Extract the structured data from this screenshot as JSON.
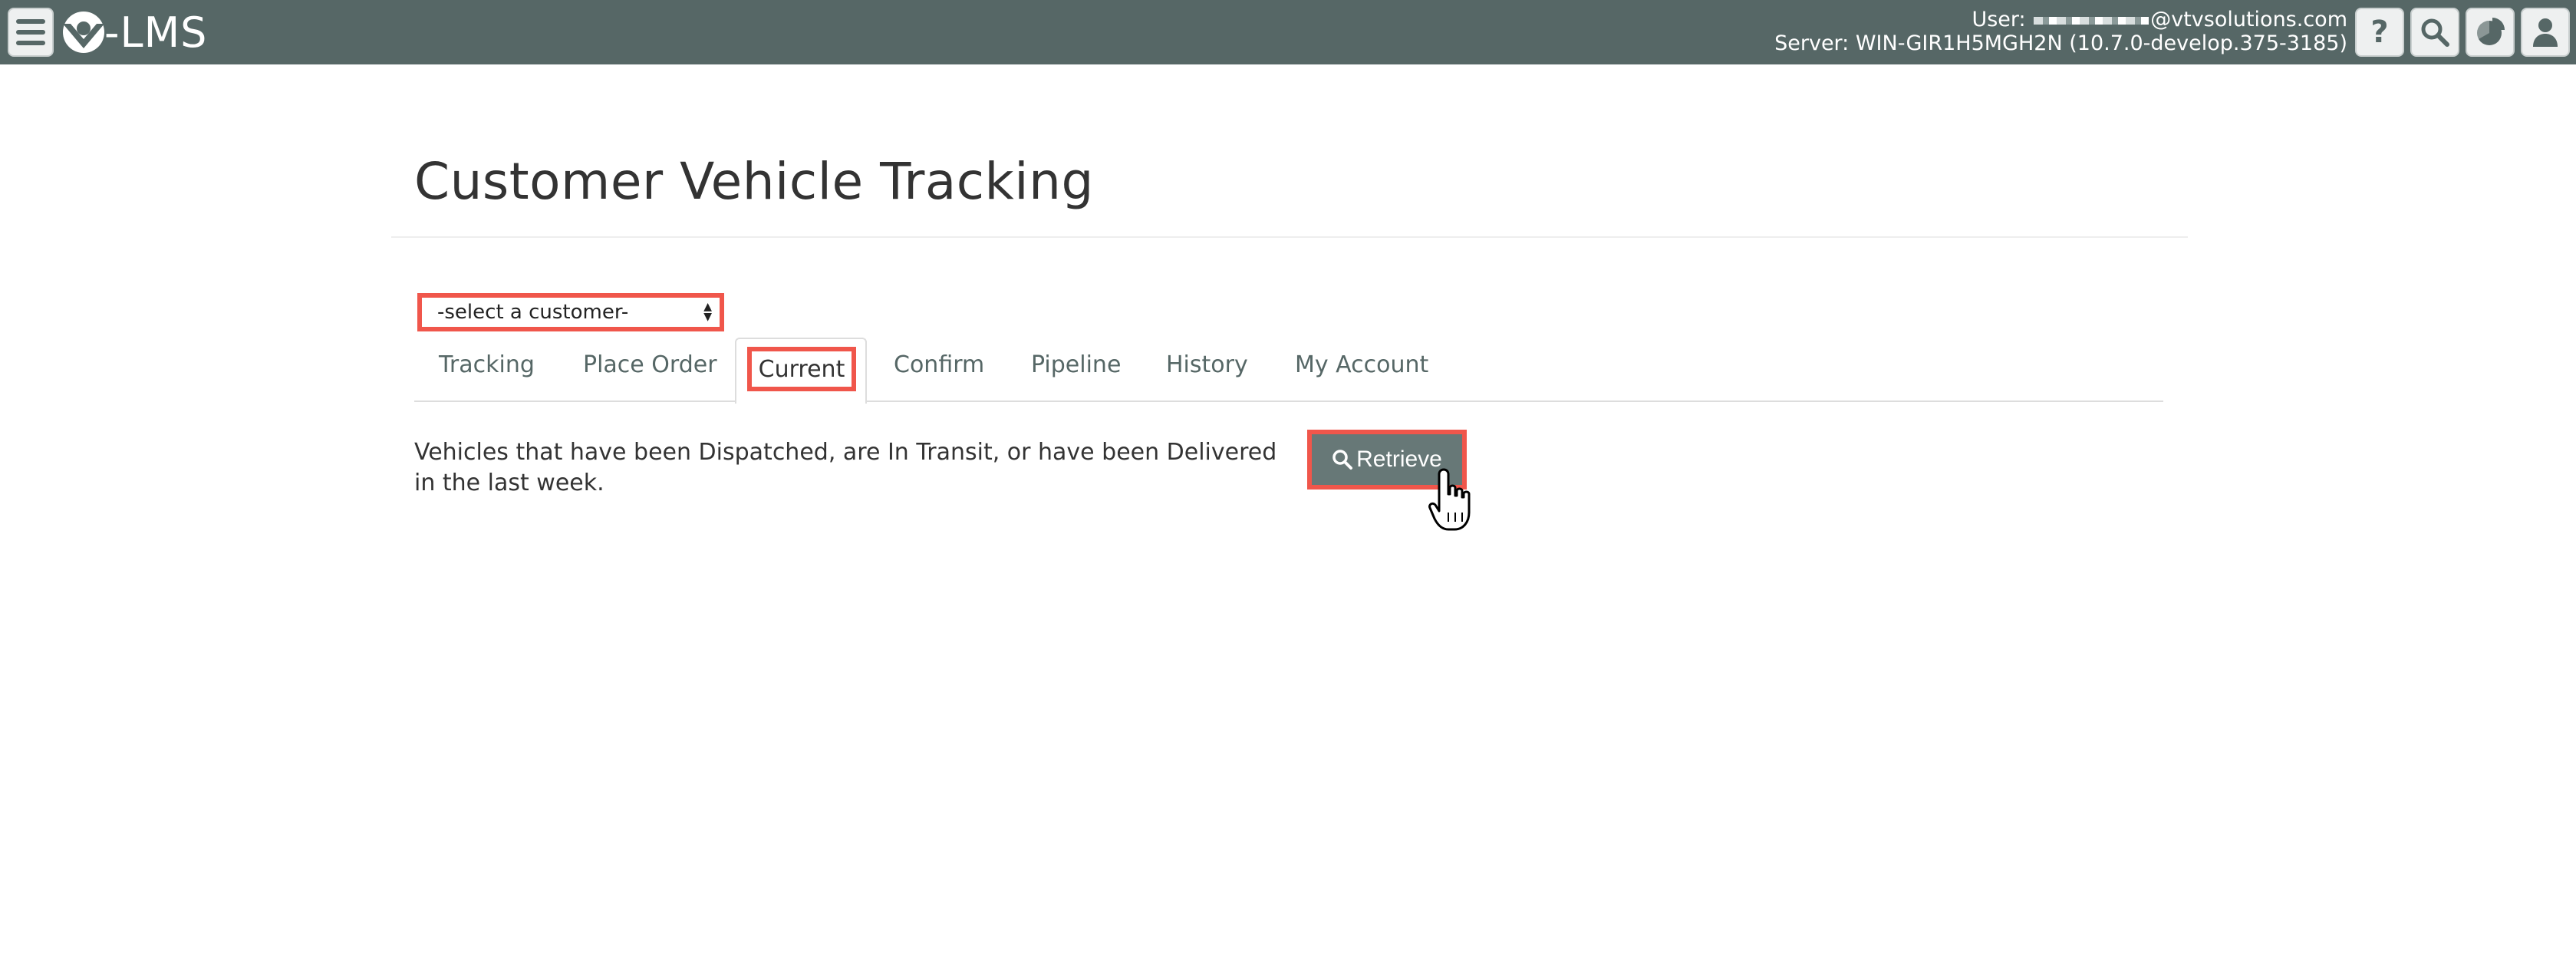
{
  "app": {
    "logo_text": "-LMS"
  },
  "topbar": {
    "user_prefix": "User:",
    "user_email_suffix": "@vtvsolutions.com",
    "server_line": "Server: WIN-GIR1H5MGH2N (10.7.0-develop.375-3185)",
    "icons": [
      "menu-icon",
      "help-icon",
      "search-icon",
      "pie-chart-icon",
      "user-icon"
    ],
    "help_glyph": "?"
  },
  "page": {
    "title": "Customer Vehicle Tracking"
  },
  "customer_select": {
    "selected": "-select a customer-"
  },
  "tabs": [
    {
      "label": "Tracking"
    },
    {
      "label": "Place Order"
    },
    {
      "label": "Current",
      "active": true
    },
    {
      "label": "Confirm"
    },
    {
      "label": "Pipeline"
    },
    {
      "label": "History"
    },
    {
      "label": "My Account"
    }
  ],
  "content": {
    "description": "Vehicles that have been Dispatched, are In Transit, or have been Delivered in the last week.",
    "retrieve_label": "Retrieve"
  },
  "colors": {
    "topbar": "#566766",
    "highlight": "#f0564b",
    "button": "#677877"
  }
}
